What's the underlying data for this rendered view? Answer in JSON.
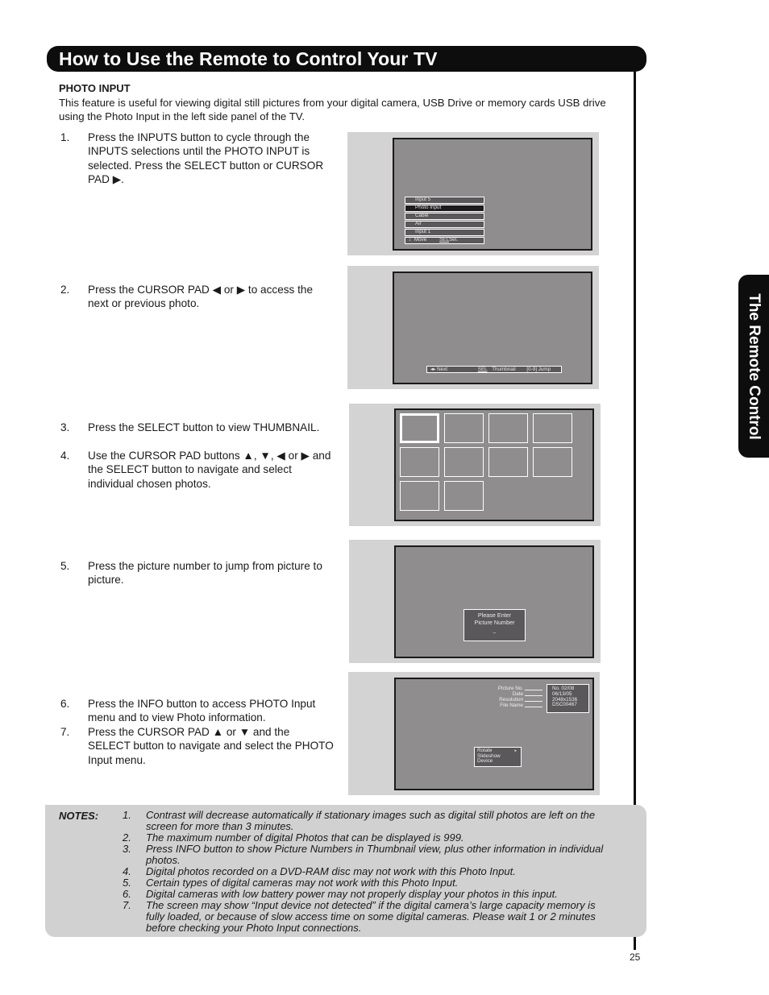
{
  "header": {
    "title": "How to Use the Remote to Control Your TV"
  },
  "side_tab": {
    "label": "The Remote Control"
  },
  "section": {
    "heading": "PHOTO INPUT",
    "intro": "This feature is useful for viewing digital still pictures from your digital camera, USB Drive or memory cards USB drive using the Photo Input in the left side panel of the TV."
  },
  "steps": [
    {
      "num": "1.",
      "text": "Press the INPUTS button to cycle through the INPUTS selections until the PHOTO INPUT is selected.  Press the SELECT button or CURSOR PAD ▶."
    },
    {
      "num": "2.",
      "text": "Press the CURSOR PAD ◀ or ▶ to access the next or previous photo."
    },
    {
      "num": "3.",
      "text": "Press the SELECT button to view THUMBNAIL."
    },
    {
      "num": "4.",
      "text": "Use the CURSOR PAD buttons ▲, ▼, ◀ or ▶ and the SELECT button to navigate and select individual chosen photos."
    },
    {
      "num": "5.",
      "text": "Press the picture number to jump from picture to picture."
    },
    {
      "num": "6.",
      "text": "Press the INFO button to access PHOTO Input menu and to view Photo information."
    },
    {
      "num": "7.",
      "text": "Press the CURSOR PAD ▲ or ▼ and the SELECT button to navigate and select the PHOTO Input menu."
    }
  ],
  "screens": {
    "inputs_menu": {
      "items": [
        "Input 5",
        "Photo Input",
        "Cable",
        "Air",
        "Input 1"
      ],
      "selected_index": 1,
      "footer": {
        "move_icon": "↕",
        "move": "Move",
        "sel_key": "SEL",
        "sel": "Sel."
      }
    },
    "photo_nav": {
      "next_icon": "◂▸",
      "next": "Next",
      "sel_key": "SEL",
      "thumbnail": "Thumbnail",
      "jump_key": "[0-9]",
      "jump": "Jump"
    },
    "thumbnails": {
      "count": 10,
      "selected_index": 0
    },
    "jump_dialog": {
      "line1": "Please Enter",
      "line2": "Picture Number",
      "value": "--"
    },
    "info": {
      "labels": [
        "Picture No.",
        "Date",
        "Resolution",
        "File Name"
      ],
      "values": [
        "No. 02/08",
        "06/13/05",
        "2048x1536",
        "DSC00467"
      ],
      "menu": [
        "Rotate",
        "Slideshow",
        "Device"
      ],
      "menu_arrow": "▸"
    }
  },
  "notes": {
    "label": "NOTES:",
    "items": [
      {
        "num": "1.",
        "text": "Contrast will decrease automatically if stationary images such as digital still photos are left on the screen for more than 3 minutes."
      },
      {
        "num": "2.",
        "text": "The maximum number of digital Photos that can be displayed is 999."
      },
      {
        "num": "3.",
        "text": "Press INFO button to show Picture Numbers in Thumbnail view, plus other information in individual photos."
      },
      {
        "num": "4.",
        "text": "Digital photos recorded on a DVD-RAM disc may not work with this Photo Input."
      },
      {
        "num": "5.",
        "text": "Certain types of digital cameras may not work with this Photo Input."
      },
      {
        "num": "6.",
        "text": "Digital cameras with low battery power may not properly display your photos in this input."
      },
      {
        "num": "7.",
        "text": "The screen may show “Input device not detected” if the digital camera’s large capacity memory is fully loaded, or because of slow access time on some digital cameras.  Please wait 1 or 2 minutes before checking your Photo Input connections."
      }
    ]
  },
  "page_number": "25"
}
